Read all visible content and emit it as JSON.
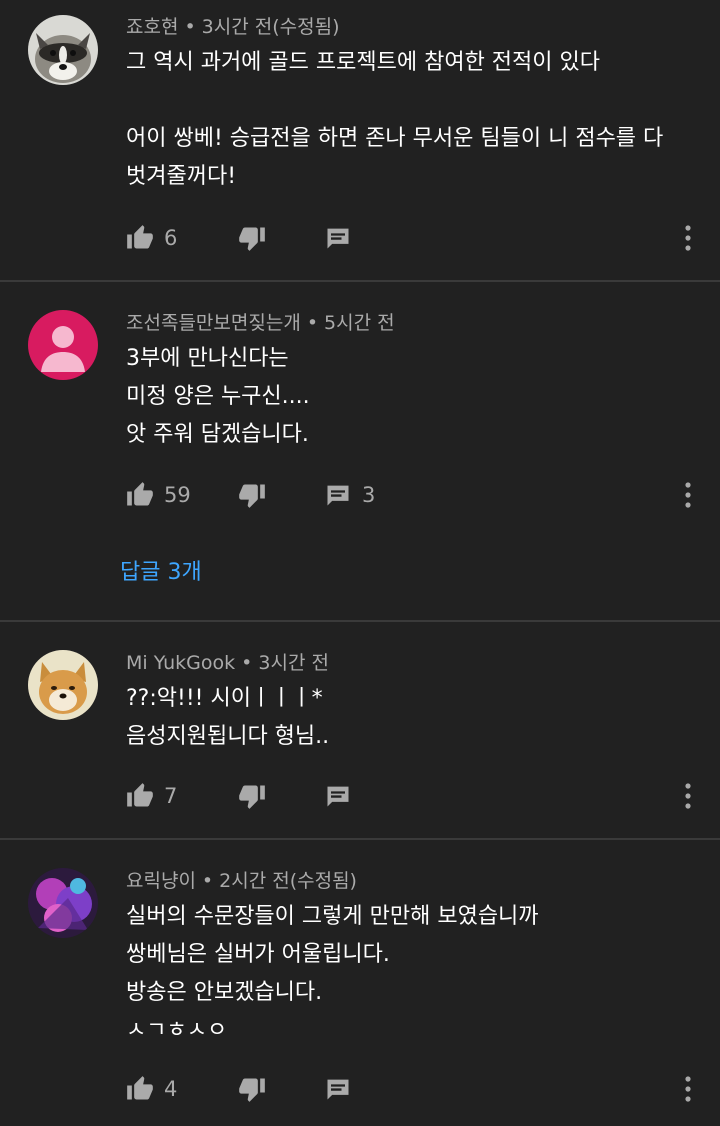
{
  "comments": [
    {
      "author": "죠호현",
      "time": "3시간 전(수정됨)",
      "text": "그 역시 과거에 골드 프로젝트에 참여한 전적이 있다\n\n어이 쌍베! 승급전을 하면 존나 무서운 팀들이 니 점수를 다\n벗겨줄꺼다!",
      "likes": "6",
      "reply_count": "",
      "avatar": "raccoon-avatar"
    },
    {
      "author": "조선족들만보면짖는개",
      "time": "5시간 전",
      "text": "3부에 만나신다는\n미정 양은 누구신....\n앗 주워 담겠습니다.",
      "likes": "59",
      "reply_count": "3",
      "replies_link": "답글 3개",
      "avatar": "default-avatar",
      "avatar_color": "#d81b60"
    },
    {
      "author": "Mi YukGook",
      "time": "3시간 전",
      "text": "??:악!!! 시이ㅣㅣㅣ*\n음성지원됩니다 형님..",
      "likes": "7",
      "reply_count": "",
      "avatar": "shiba-avatar"
    },
    {
      "author": "요릭냥이",
      "time": "2시간 전(수정됨)",
      "text": "실버의 수문장들이 그렇게 만만해 보였습니까\n쌍베님은 실버가 어울립니다.\n방송은 안보겠습니다.\nㅅㄱㅎㅅㅇ",
      "likes": "4",
      "reply_count": "",
      "avatar": "purple-art-avatar"
    }
  ],
  "separator": "•",
  "icons": {
    "like": "thumb-up-icon",
    "dislike": "thumb-down-icon",
    "reply": "reply-icon",
    "more": "more-vert-icon"
  },
  "colors": {
    "background": "#212121",
    "meta_text": "#aaaaaa",
    "link": "#3ea6ff",
    "divider": "#3a3a3a"
  }
}
